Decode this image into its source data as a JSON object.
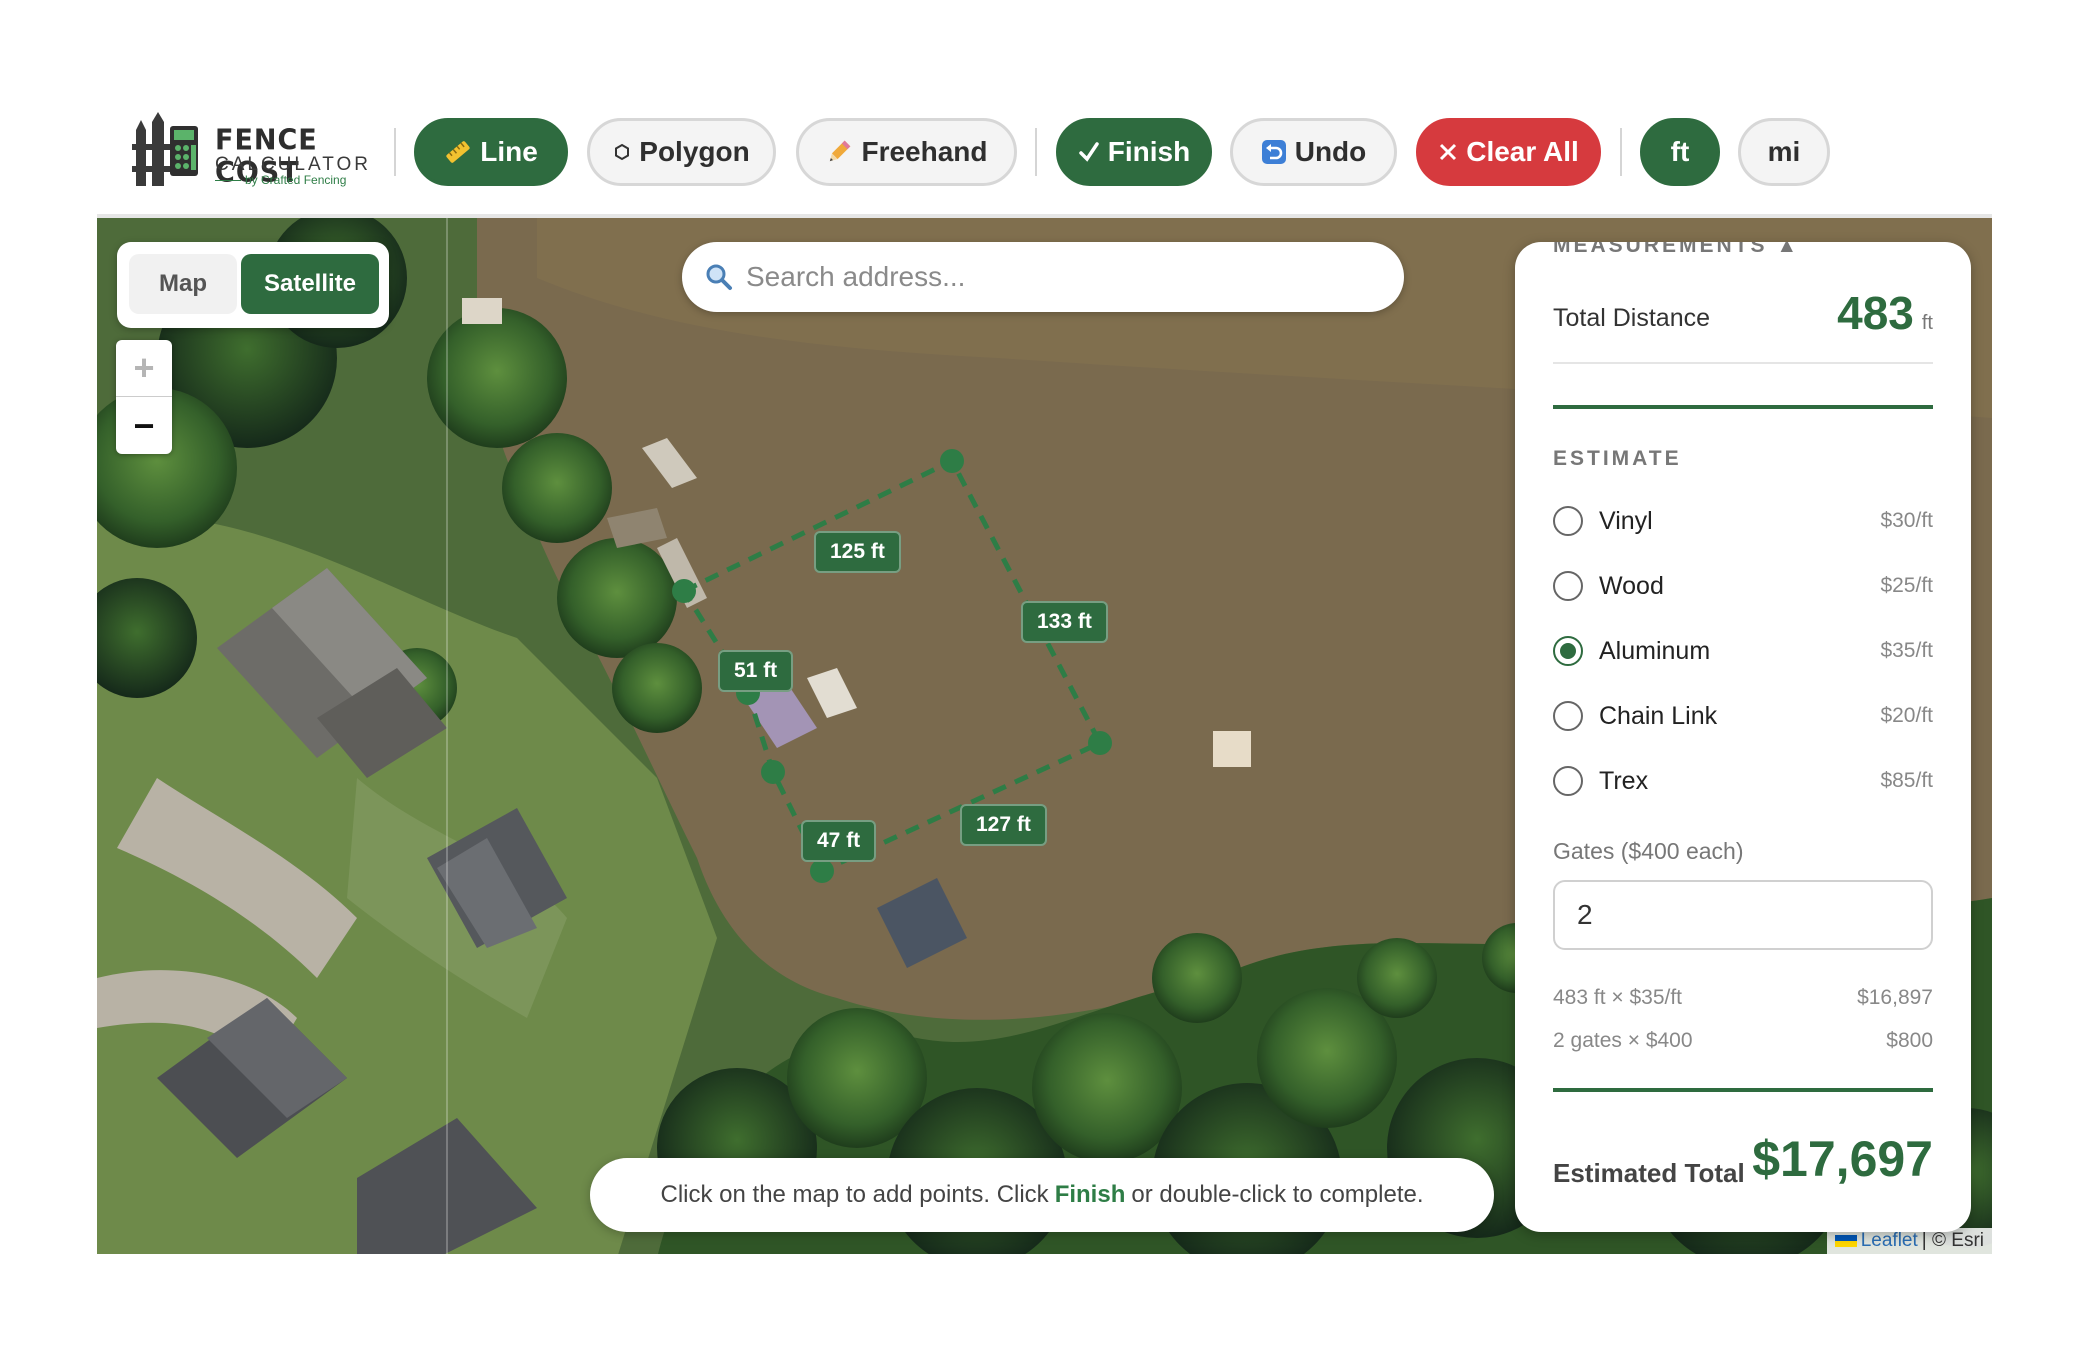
{
  "app": {
    "logo_line1": "FENCE COST",
    "logo_line2": "CALCULATOR",
    "logo_line3": "by Crafted Fencing"
  },
  "toolbar": {
    "line": "Line",
    "polygon": "Polygon",
    "freehand": "Freehand",
    "finish": "Finish",
    "undo": "Undo",
    "clear_all": "Clear All",
    "unit_ft": "ft",
    "unit_mi": "mi",
    "active_tool": "Line",
    "active_unit": "ft"
  },
  "map": {
    "layer_map": "Map",
    "layer_satellite": "Satellite",
    "active_layer": "Satellite",
    "zoom_in": "+",
    "zoom_out": "−",
    "search_placeholder": "Search address...",
    "segments": [
      "125 ft",
      "133 ft",
      "51 ft",
      "127 ft",
      "47 ft"
    ],
    "hint_before": "Click on the map to add points. Click",
    "hint_bold": "Finish",
    "hint_after": "or double-click to complete.",
    "attribution_link": "Leaflet",
    "attribution_rest": "| © Esri"
  },
  "panel": {
    "header": "MEASUREMENTS ▲",
    "total_distance_label": "Total Distance",
    "total_distance_value": "483",
    "total_distance_unit": "ft",
    "estimate_header": "ESTIMATE",
    "materials": [
      {
        "name": "Vinyl",
        "price": "$30/ft",
        "selected": false
      },
      {
        "name": "Wood",
        "price": "$25/ft",
        "selected": false
      },
      {
        "name": "Aluminum",
        "price": "$35/ft",
        "selected": true
      },
      {
        "name": "Chain Link",
        "price": "$20/ft",
        "selected": false
      },
      {
        "name": "Trex",
        "price": "$85/ft",
        "selected": false
      }
    ],
    "gates_label": "Gates ($400 each)",
    "gates_value": "2",
    "calc": [
      {
        "label": "483 ft × $35/ft",
        "value": "$16,897"
      },
      {
        "label": "2 gates × $400",
        "value": "$800"
      }
    ],
    "total_label": "Estimated Total",
    "total_value": "$17,697"
  },
  "colors": {
    "brand_green": "#2e6b3f",
    "danger_red": "#d63a3e",
    "water": "#7a6a4e"
  }
}
